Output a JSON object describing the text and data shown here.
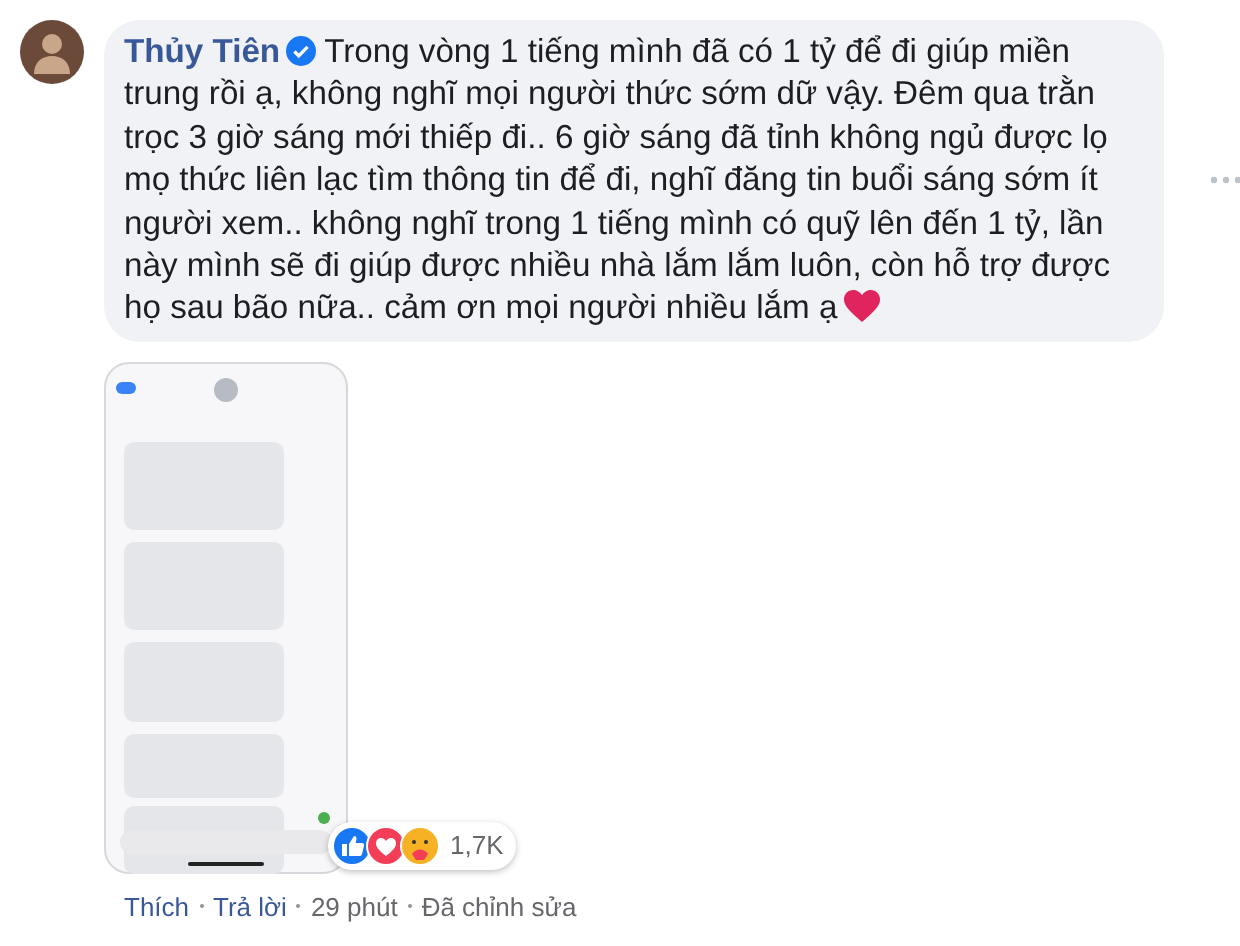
{
  "comment": {
    "author": "Thủy Tiên",
    "verified": true,
    "text": "Trong vòng 1 tiếng mình đã có 1 tỷ để đi giúp miền trung rồi ạ, không nghĩ mọi người thức sớm dữ vậy. Đêm qua trằn trọc 3 giờ sáng mới thiếp đi.. 6 giờ sáng đã tỉnh không ngủ được lọ mọ thức liên lạc tìm thông tin để đi, nghĩ đăng tin buổi sáng sớm ít người xem.. không nghĩ trong 1 tiếng mình có quỹ lên đến 1 tỷ, lần này mình sẽ đi giúp được nhiều nhà lắm lắm luôn, còn hỗ trợ được họ sau bão nữa.. cảm ơn mọi người nhiều lắm ạ",
    "reactions": {
      "count": "1,7K"
    },
    "actions": [
      {
        "label": "Thích",
        "kind": "link"
      },
      {
        "label": "Trả lời",
        "kind": "link"
      },
      {
        "label": "29 phút",
        "kind": "text"
      },
      {
        "label": "Đã chỉnh sửa",
        "kind": "text"
      }
    ]
  }
}
